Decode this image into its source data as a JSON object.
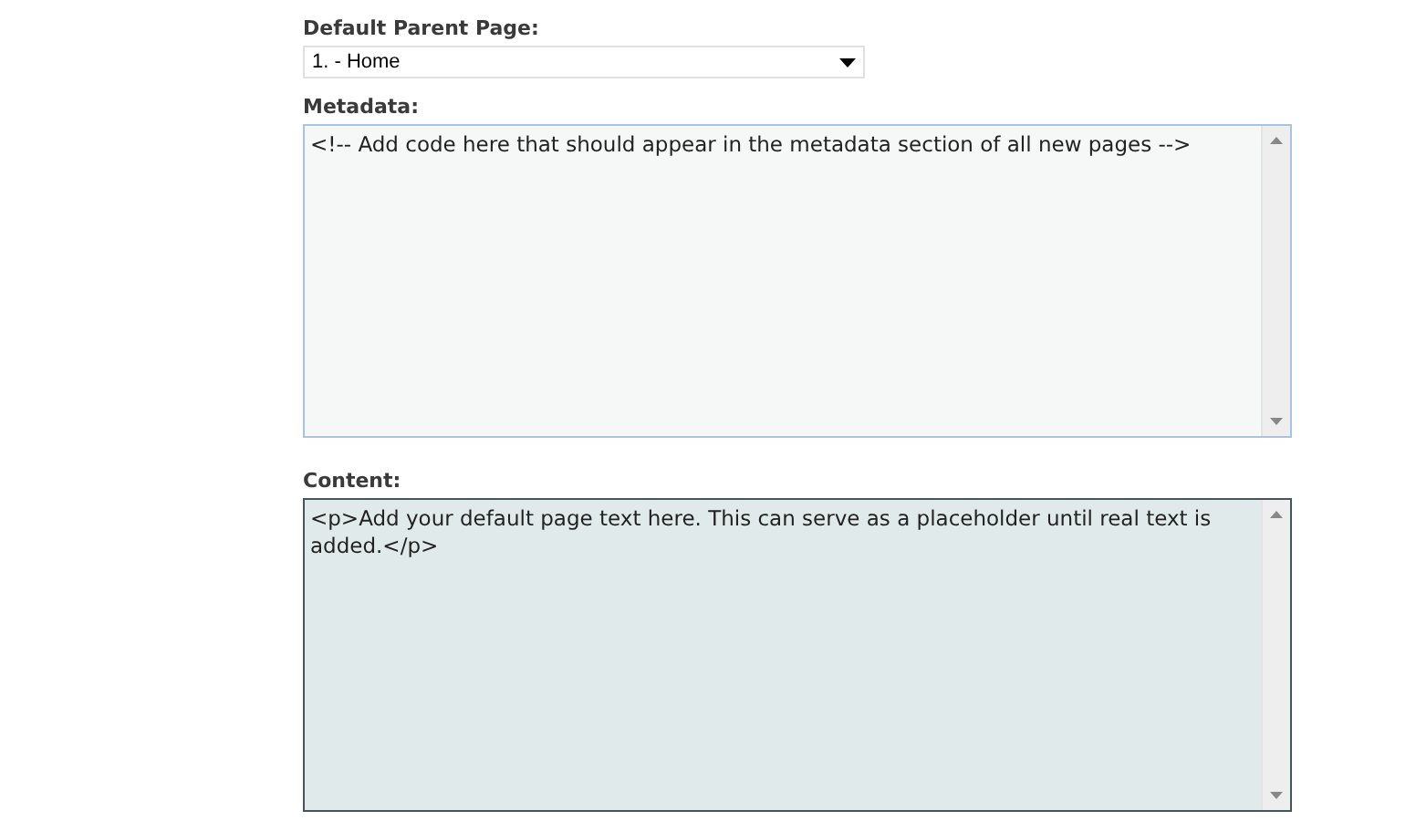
{
  "fields": [
    {
      "kind": "select",
      "label": "Default Parent Page:",
      "value": "1. - Home"
    },
    {
      "kind": "textarea",
      "label": "Metadata:",
      "value": "<!-- Add code here that should appear in the metadata section of all new pages -->",
      "focused": false
    },
    {
      "kind": "textarea",
      "label": "Content:",
      "value": "<p>Add your default page text here. This can serve as a placeholder until real text is added.</p>",
      "focused": true
    }
  ]
}
